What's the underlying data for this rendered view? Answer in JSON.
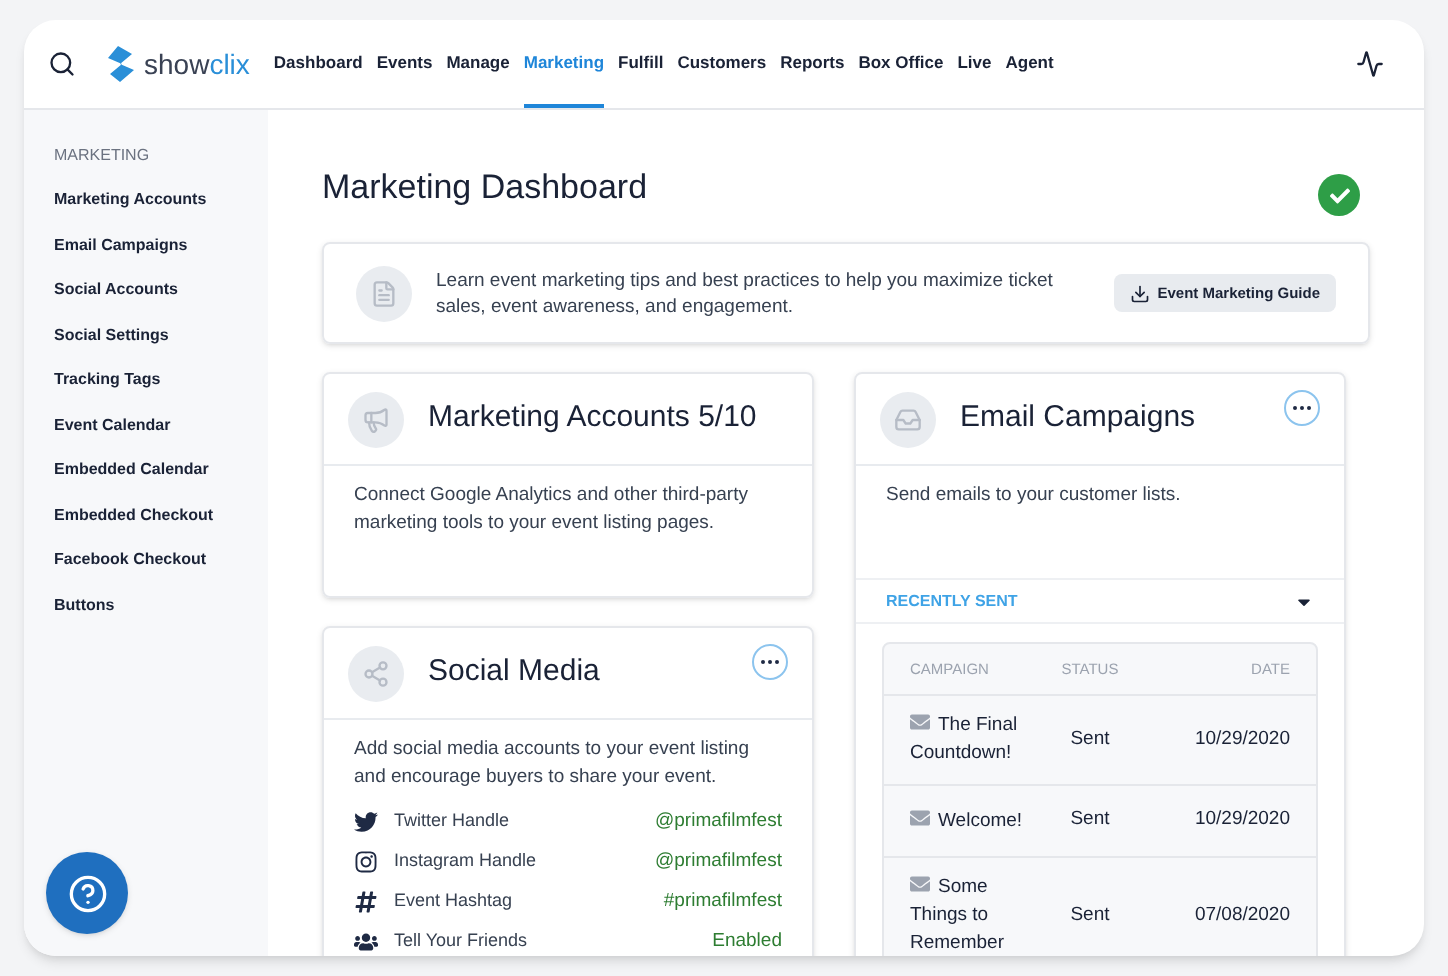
{
  "logo": {
    "part_1": "show",
    "part_2": "clix"
  },
  "nav": [
    {
      "label": "Dashboard",
      "selected": false
    },
    {
      "label": "Events",
      "selected": false
    },
    {
      "label": "Manage",
      "selected": false
    },
    {
      "label": "Marketing",
      "selected": true
    },
    {
      "label": "Fulfill",
      "selected": false
    },
    {
      "label": "Customers",
      "selected": false
    },
    {
      "label": "Reports",
      "selected": false
    },
    {
      "label": "Box Office",
      "selected": false
    },
    {
      "label": "Live",
      "selected": false
    },
    {
      "label": "Agent",
      "selected": false
    }
  ],
  "sidebar": {
    "heading": "MARKETING",
    "items": [
      "Marketing Accounts",
      "Email Campaigns",
      "Social Accounts",
      "Social Settings",
      "Tracking Tags",
      "Event Calendar",
      "Embedded Calendar",
      "Embedded Checkout",
      "Facebook Checkout",
      "Buttons"
    ]
  },
  "page": {
    "title": "Marketing Dashboard",
    "complete": true
  },
  "info": {
    "text": "Learn event marketing tips and best practices to help you maximize ticket sales, event awareness, and engagement.",
    "button": "Event Marketing Guide"
  },
  "marketing_accounts": {
    "title": "Marketing Accounts 5/10",
    "text": "Connect Google Analytics and other third-party marketing tools to your event listing pages."
  },
  "social_media": {
    "title": "Social Media",
    "text": "Add social media accounts to your event listing and encourage buyers to share your event.",
    "rows": [
      {
        "kind": "twitter",
        "label": "Twitter Handle",
        "value": "@primafilmfest"
      },
      {
        "kind": "instagram",
        "label": "Instagram Handle",
        "value": "@primafilmfest"
      },
      {
        "kind": "hashtag",
        "label": "Event Hashtag",
        "value": "#primafilmfest"
      },
      {
        "kind": "group",
        "label": "Tell Your Friends",
        "value": "Enabled"
      }
    ]
  },
  "email_campaigns": {
    "title": "Email Campaigns",
    "text": "Send emails to your customer lists.",
    "section": "RECENTLY SENT",
    "table": {
      "columns": [
        "CAMPAIGN",
        "STATUS",
        "DATE"
      ],
      "rows": [
        {
          "campaign": "The Final Countdown!",
          "status": "Sent",
          "date": "10/29/2020"
        },
        {
          "campaign": "Welcome!",
          "status": "Sent",
          "date": "10/29/2020"
        },
        {
          "campaign": "Some Things to Remember",
          "status": "Sent",
          "date": "07/08/2020"
        }
      ]
    }
  }
}
